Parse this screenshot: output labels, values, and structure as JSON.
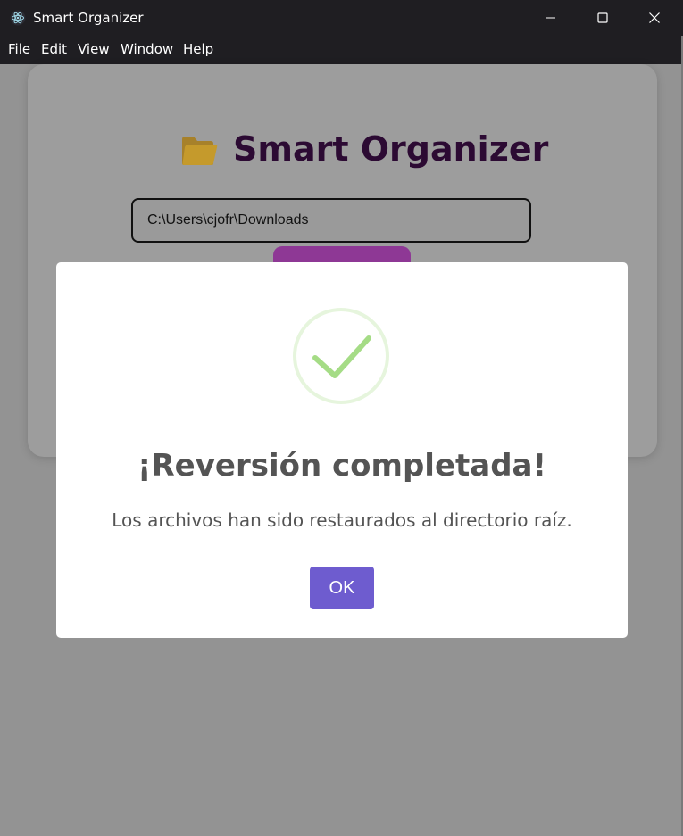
{
  "window": {
    "title": "Smart Organizer",
    "icons": {
      "app": "electron-app-icon",
      "minimize": "minimize-icon",
      "maximize": "maximize-icon",
      "close": "close-icon"
    }
  },
  "menubar": {
    "items": [
      "File",
      "Edit",
      "View",
      "Window",
      "Help"
    ]
  },
  "app": {
    "heading": "Smart Organizer",
    "heading_icon": "folder-icon",
    "path_value": "C:\\Users\\cjofr\\Downloads",
    "colors": {
      "heading": "#2c0a33",
      "button": "#8e3895"
    }
  },
  "dialog": {
    "icon": "success-checkmark-icon",
    "title": "¡Reversión completada!",
    "message": "Los archivos han sido restaurados al directorio raíz.",
    "ok_label": "OK",
    "colors": {
      "ok_button": "#6e5ccf",
      "check": "#a5dc86",
      "text": "#545454"
    }
  }
}
